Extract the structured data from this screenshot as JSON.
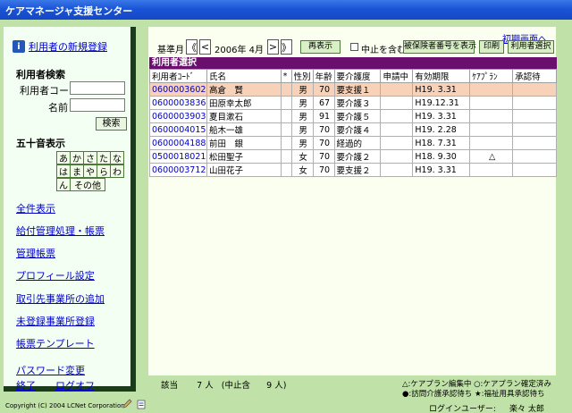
{
  "window": {
    "title": "ケアマネージャ支援センター"
  },
  "sidebar": {
    "new_user": "利用者の新規登録",
    "search_heading": "利用者検索",
    "user_code_label": "利用者コード",
    "name_label": "名前",
    "search_button": "検索",
    "kana_heading": "五十音表示",
    "kana_row1": [
      "あ",
      "か",
      "さ",
      "た",
      "な"
    ],
    "kana_row2": [
      "は",
      "ま",
      "や",
      "ら",
      "わ"
    ],
    "kana_row3_first": "ん",
    "kana_other": "その他",
    "links": {
      "show_all": "全件表示",
      "benefit": "給付管理処理・帳票",
      "manage_forms": "管理帳票",
      "profile": "プロフィール設定",
      "add_office": "取引先事業所の追加",
      "unregistered": "未登録事業所登録",
      "template": "帳票テンプレート",
      "password": "パスワード変更",
      "exit": "終了",
      "logoff": "ログオフ"
    }
  },
  "toolbar": {
    "base_month_label": "基準月",
    "prev_prev": "《",
    "prev": "<",
    "month": "2006年 4月",
    "next": ">",
    "next_next": "》",
    "redisplay": "再表示",
    "include_stopped": "中止を含む",
    "show_insured_no": "被保険者番号を表示",
    "print": "印刷",
    "select_user": "利用者選択",
    "initial_screen": "初期画面へ"
  },
  "list": {
    "title": "利用者選択",
    "headers": [
      "利用者ｺｰﾄﾞ",
      "氏名",
      "*",
      "性別",
      "年齢",
      "要介護度",
      "申請中",
      "有効期限",
      "ｹｱﾌﾟﾗﾝ",
      "承認待"
    ],
    "rows": [
      [
        "0600003602",
        "高倉　賢",
        "",
        "男",
        "70",
        "要支援１",
        "",
        "H19. 3.31",
        "",
        ""
      ],
      [
        "0600003836",
        "田原幸太郎",
        "",
        "男",
        "67",
        "要介護３",
        "",
        "H19.12.31",
        "",
        ""
      ],
      [
        "0600003903",
        "夏目漱石",
        "",
        "男",
        "91",
        "要介護５",
        "",
        "H19. 3.31",
        "",
        ""
      ],
      [
        "0600004015",
        "船木一雄",
        "",
        "男",
        "70",
        "要介護４",
        "",
        "H19. 2.28",
        "",
        ""
      ],
      [
        "0600004188",
        "前田　銀",
        "",
        "男",
        "70",
        "経過的",
        "",
        "H18. 7.31",
        "",
        ""
      ],
      [
        "0500018021",
        "松田聖子",
        "",
        "女",
        "70",
        "要介護２",
        "",
        "H18. 9.30",
        "△",
        ""
      ],
      [
        "0600003712",
        "山田花子",
        "",
        "女",
        "70",
        "要支援２",
        "",
        "H19. 3.31",
        "",
        ""
      ]
    ]
  },
  "footer": {
    "count_label": "該当",
    "count": "7 人",
    "stopped_note": "(中止含",
    "stopped_count": "9 人)",
    "legend1": "△:ケアプラン編集中  ○:ケアプラン確定済み",
    "legend2": "●:訪問介護承認待ち  ★:福祉用具承認待ち",
    "copyright": "Copyright (C) 2004 LCNet Corporation",
    "login_label": "ログインユーザー:",
    "login_user": "楽々 太郎"
  }
}
